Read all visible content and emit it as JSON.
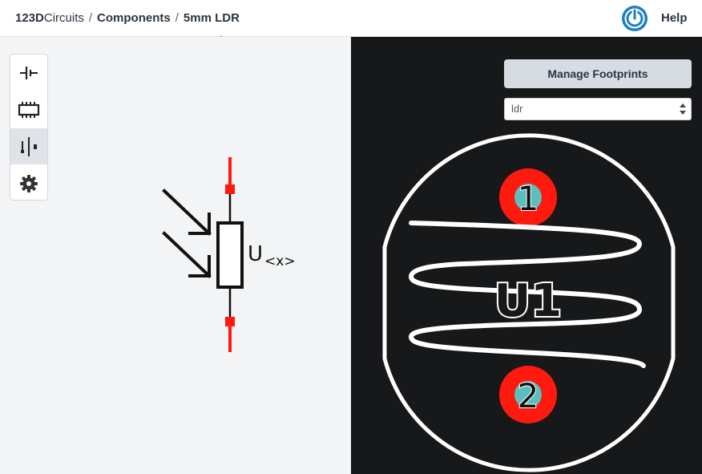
{
  "header": {
    "breadcrumb": {
      "brand_bold": "123D",
      "brand_rest": "Circuits",
      "separator": "/",
      "items": [
        "Components",
        "5mm LDR"
      ]
    },
    "help_label": "Help"
  },
  "toolbar": {
    "tools": [
      {
        "name": "battery-symbol-tool",
        "icon": "battery-icon"
      },
      {
        "name": "chip-footprint-tool",
        "icon": "chip-icon"
      },
      {
        "name": "pin-tool",
        "icon": "pin-icon",
        "active": true
      },
      {
        "name": "settings-tool",
        "icon": "gear-icon"
      }
    ]
  },
  "schematic": {
    "designator": "U",
    "designator_suffix": "<x>"
  },
  "footprint_panel": {
    "manage_button_label": "Manage Footprints",
    "select_value": "ldr",
    "pads": [
      "1",
      "2"
    ],
    "silkscreen_label": "U1"
  },
  "colors": {
    "accent_blue": "#1d7fc1",
    "annotation_red": "#f2452e",
    "pin_red": "#ff1a0f",
    "pad_teal": "#5bbfbf",
    "pcb_background": "#17181a"
  }
}
